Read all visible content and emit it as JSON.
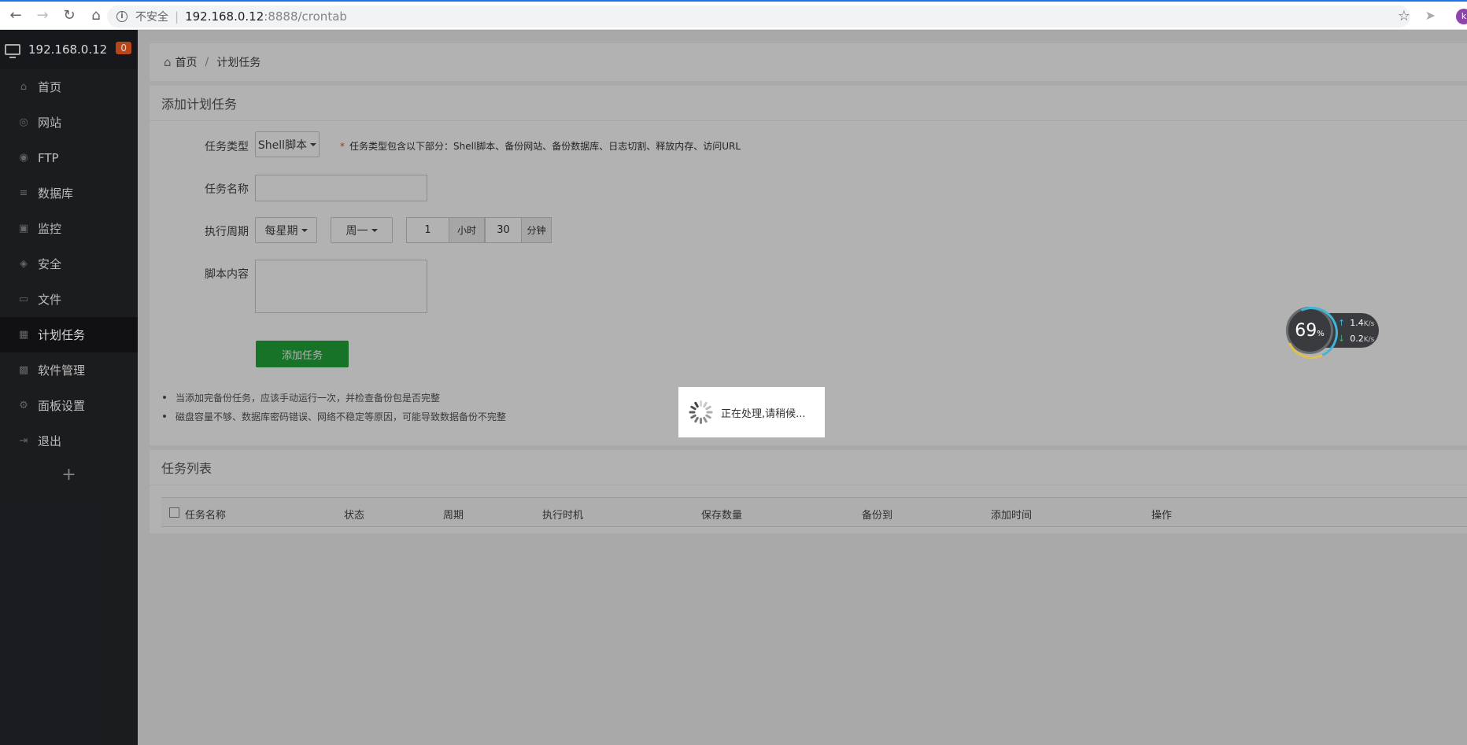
{
  "browser": {
    "security_label": "不安全",
    "url_host": "192.168.0.12",
    "url_path": ":8888/crontab",
    "avatar_letter": "k"
  },
  "sidebar": {
    "host": "192.168.0.12",
    "badge": "0",
    "items": [
      {
        "label": "首页",
        "icon": "home-icon"
      },
      {
        "label": "网站",
        "icon": "globe-icon"
      },
      {
        "label": "FTP",
        "icon": "ftp-icon"
      },
      {
        "label": "数据库",
        "icon": "database-icon"
      },
      {
        "label": "监控",
        "icon": "monitor-icon"
      },
      {
        "label": "安全",
        "icon": "shield-icon"
      },
      {
        "label": "文件",
        "icon": "folder-icon"
      },
      {
        "label": "计划任务",
        "icon": "calendar-icon"
      },
      {
        "label": "软件管理",
        "icon": "grid-icon"
      },
      {
        "label": "面板设置",
        "icon": "gear-icon"
      },
      {
        "label": "退出",
        "icon": "logout-icon"
      }
    ],
    "add": "+"
  },
  "breadcrumb": {
    "home": "首页",
    "current": "计划任务"
  },
  "add_panel": {
    "title": "添加计划任务",
    "task_type_label": "任务类型",
    "task_type_value": "Shell脚本",
    "task_type_hint": "任务类型包含以下部分：Shell脚本、备份网站、备份数据库、日志切割、释放内存、访问URL",
    "task_name_label": "任务名称",
    "task_name_value": "",
    "cycle_label": "执行周期",
    "cycle_value": "每星期",
    "weekday_value": "周一",
    "hour_value": "1",
    "hour_unit": "小时",
    "minute_value": "30",
    "minute_unit": "分钟",
    "script_label": "脚本内容",
    "submit_label": "添加任务",
    "notes": [
      "当添加完备份任务，应该手动运行一次，并检查备份包是否完整",
      "磁盘容量不够、数据库密码错误、网络不稳定等原因，可能导致数据备份不完整"
    ]
  },
  "list_panel": {
    "title": "任务列表",
    "columns": [
      "任务名称",
      "状态",
      "周期",
      "执行时机",
      "保存数量",
      "备份到",
      "添加时间",
      "操作"
    ]
  },
  "loading": {
    "text": "正在处理,请稍候..."
  },
  "gauge": {
    "percent": "69",
    "percent_sign": "%",
    "up": "1.4",
    "down": "0.2",
    "unit": "K/s"
  },
  "colors": {
    "accent_green": "#20a53a",
    "badge": "#d9531e",
    "sidebar_bg": "#202124"
  }
}
